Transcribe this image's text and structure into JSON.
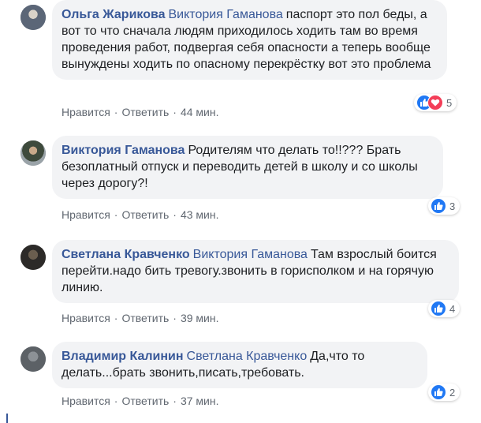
{
  "comments": [
    {
      "author": "Ольга Жарикова",
      "mention": "Виктория Гаманова",
      "text": "паспорт это пол беды, а вот то что сначала людям приходилось ходить там во время проведения работ, подвергая себя опасности а теперь вообще вынуждены ходить по опасному перекрёстку вот это проблема",
      "like_label": "Нравится",
      "reply_label": "Ответить",
      "time": "44 мин.",
      "reaction_count": "5",
      "reactions": [
        "like-icon",
        "love-icon"
      ]
    },
    {
      "author": "Виктория Гаманова",
      "mention": "",
      "text": "Родителям что делать то!!??? Брать безоплатный отпуск и переводить детей в школу и со школы через дорогу?!",
      "like_label": "Нравится",
      "reply_label": "Ответить",
      "time": "43 мин.",
      "reaction_count": "3",
      "reactions": [
        "like-icon"
      ]
    },
    {
      "author": "Светлана Кравченко",
      "mention": "Виктория Гаманова",
      "text": "Там взрослый боится перейти.надо бить тревогу.звонить в горисполком и на горячую линию.",
      "like_label": "Нравится",
      "reply_label": "Ответить",
      "time": "39 мин.",
      "reaction_count": "4",
      "reactions": [
        "like-icon"
      ]
    },
    {
      "author": "Владимир Калинин",
      "mention": "Светлана Кравченко",
      "text": "Да,что то делать...брать звонить,писать,требовать.",
      "like_label": "Нравится",
      "reply_label": "Ответить",
      "time": "37 мин.",
      "reaction_count": "2",
      "reactions": [
        "like-icon"
      ]
    }
  ],
  "colors": {
    "link": "#385898",
    "bubble_bg": "#f2f3f5",
    "meta_text": "#606770",
    "like": "#2078f4",
    "love": "#f33e58"
  }
}
